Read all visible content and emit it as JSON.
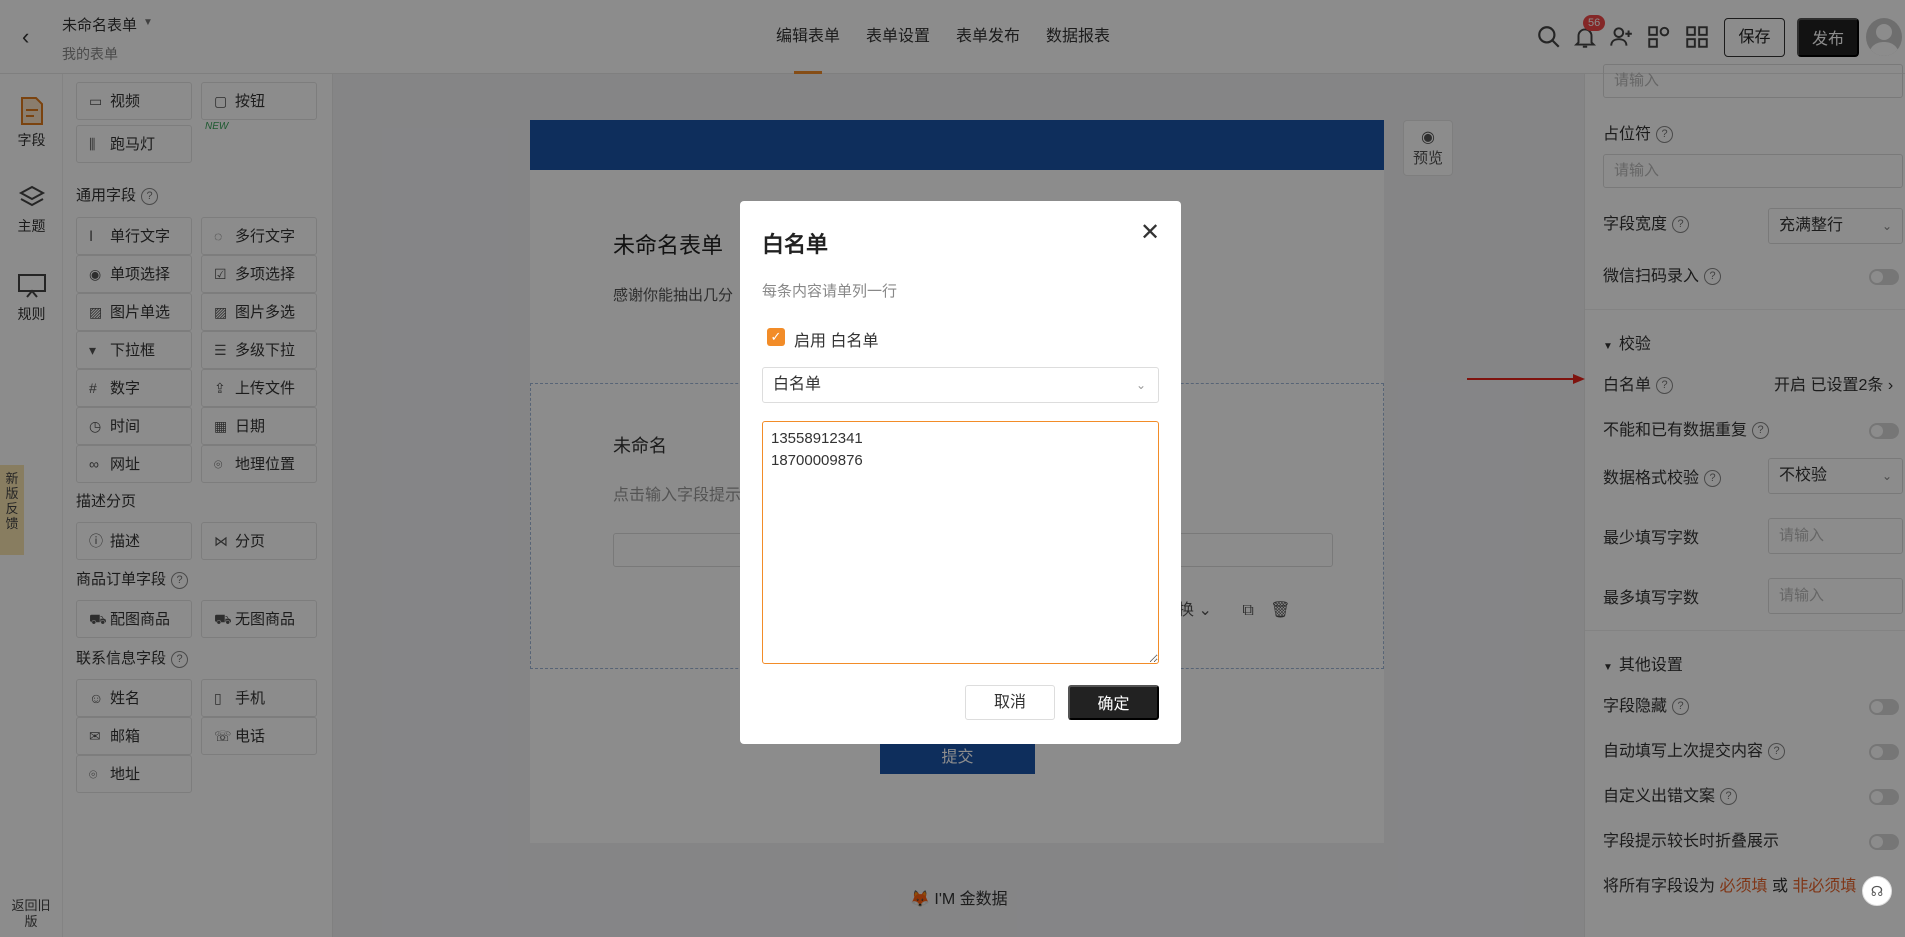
{
  "header": {
    "form_name": "未命名表单",
    "breadcrumb": "我的表单",
    "tabs": [
      "编辑表单",
      "表单设置",
      "表单发布",
      "数据报表"
    ],
    "notification_count": "56",
    "save_label": "保存",
    "publish_label": "发布"
  },
  "rail": {
    "items": [
      "字段",
      "主题",
      "规则"
    ],
    "feedback": "新版反馈",
    "old_version": "返回旧版"
  },
  "palette": {
    "top_items": [
      "视频",
      "按钮",
      "跑马灯"
    ],
    "new_tag": "NEW",
    "common_title": "通用字段",
    "common_items": [
      "单行文字",
      "多行文字",
      "单项选择",
      "多项选择",
      "图片单选",
      "图片多选",
      "下拉框",
      "多级下拉",
      "数字",
      "上传文件",
      "时间",
      "日期",
      "网址",
      "地理位置"
    ],
    "desc_title": "描述分页",
    "desc_items": [
      "描述",
      "分页"
    ],
    "product_title": "商品订单字段",
    "product_items": [
      "配图商品",
      "无图商品"
    ],
    "contact_title": "联系信息字段",
    "contact_items": [
      "姓名",
      "手机",
      "邮箱",
      "电话",
      "地址"
    ]
  },
  "canvas": {
    "form_title": "未命名表单",
    "form_desc": "感谢你能抽出几分",
    "field_name": "未命名",
    "field_hint": "点击输入字段提示",
    "field_tool_text": "换",
    "submit_label": "提交",
    "preview_label": "预览",
    "brand": "I'M 金数据"
  },
  "right_panel": {
    "top_input_placeholder": "请输入",
    "placeholder_label": "占位符",
    "placeholder_input": "请输入",
    "width_label": "字段宽度",
    "width_value": "充满整行",
    "wechat_scan_label": "微信扫码录入",
    "validation_section": "校验",
    "whitelist_label": "白名单",
    "whitelist_value": "开启 已设置2条",
    "no_duplicate_label": "不能和已有数据重复",
    "format_label": "数据格式校验",
    "format_value": "不校验",
    "min_label": "最少填写字数",
    "min_placeholder": "请输入",
    "max_label": "最多填写字数",
    "max_placeholder": "请输入",
    "other_section": "其他设置",
    "hide_label": "字段隐藏",
    "autofill_label": "自动填写上次提交内容",
    "custom_error_label": "自定义出错文案",
    "collapse_label": "字段提示较长时折叠展示",
    "set_all_prefix": "将所有字段设为",
    "required_link": "必须填",
    "or_text": "或",
    "optional_link": "非必须填"
  },
  "modal": {
    "title": "白名单",
    "hint": "每条内容请单列一行",
    "enable_label": "启用 白名单",
    "select_value": "白名单",
    "textarea_value": "13558912341\n18700009876",
    "cancel_label": "取消",
    "ok_label": "确定"
  },
  "colors": {
    "accent": "#f28c28",
    "brand_blue": "#1b55a8",
    "primary_dark": "#222222"
  }
}
